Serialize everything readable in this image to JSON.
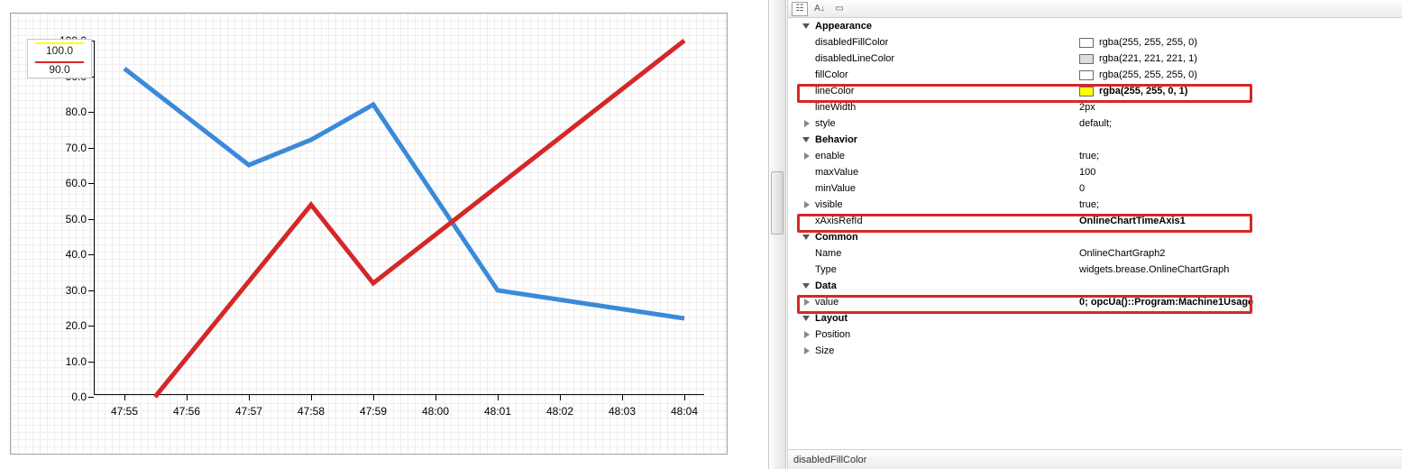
{
  "chart_data": {
    "type": "line",
    "x_ticks": [
      "47:55",
      "47:56",
      "47:57",
      "47:58",
      "47:59",
      "48:00",
      "48:01",
      "48:02",
      "48:03",
      "48:04"
    ],
    "y_ticks": [
      "0.0",
      "10.0",
      "20.0",
      "30.0",
      "40.0",
      "50.0",
      "60.0",
      "70.0",
      "80.0",
      "90.0",
      "100.0"
    ],
    "ylim": [
      0,
      100
    ],
    "series": [
      {
        "name": "blue",
        "color": "#3b8ad9",
        "x": [
          "47:55",
          "47:57",
          "47:58",
          "47:59",
          "48:01",
          "48:04"
        ],
        "values": [
          92,
          65,
          72,
          82,
          30,
          22
        ]
      },
      {
        "name": "red",
        "color": "#d62728",
        "x": [
          "47:55.5",
          "47:58",
          "47:59",
          "48:04"
        ],
        "values": [
          0,
          54,
          32,
          103
        ]
      }
    ],
    "legend": [
      {
        "color": "yellow",
        "current_value": "100.0"
      },
      {
        "color": "red",
        "current_value": "90.0"
      }
    ]
  },
  "legend": {
    "val1": "100.0",
    "val2": "90.0"
  },
  "props": {
    "categories": {
      "appearance": "Appearance",
      "behavior": "Behavior",
      "common": "Common",
      "data": "Data",
      "layout": "Layout",
      "position": "Position",
      "size": "Size"
    },
    "disabledFillColor": {
      "label": "disabledFillColor",
      "value": "rgba(255, 255, 255, 0)",
      "swatch": "rgba(255,255,255,0)"
    },
    "disabledLineColor": {
      "label": "disabledLineColor",
      "value": "rgba(221, 221, 221, 1)",
      "swatch": "rgba(221,221,221,1)"
    },
    "fillColor": {
      "label": "fillColor",
      "value": "rgba(255, 255, 255, 0)",
      "swatch": "rgba(255,255,255,0)"
    },
    "lineColor": {
      "label": "lineColor",
      "value": "rgba(255, 255, 0, 1)",
      "swatch": "rgba(255,255,0,1)"
    },
    "lineWidth": {
      "label": "lineWidth",
      "value": "2px"
    },
    "style": {
      "label": "style",
      "value": "default;"
    },
    "enable": {
      "label": "enable",
      "value": "true;"
    },
    "maxValue": {
      "label": "maxValue",
      "value": "100"
    },
    "minValue": {
      "label": "minValue",
      "value": "0"
    },
    "visible": {
      "label": "visible",
      "value": "true;"
    },
    "xAxisRefId": {
      "label": "xAxisRefId",
      "value": "OnlineChartTimeAxis1"
    },
    "name": {
      "label": "Name",
      "value": "OnlineChartGraph2"
    },
    "type": {
      "label": "Type",
      "value": "widgets.brease.OnlineChartGraph"
    },
    "valueProp": {
      "label": "value",
      "value": "0; opcUa()::Program:Machine1Usage"
    }
  },
  "status": "disabledFillColor"
}
